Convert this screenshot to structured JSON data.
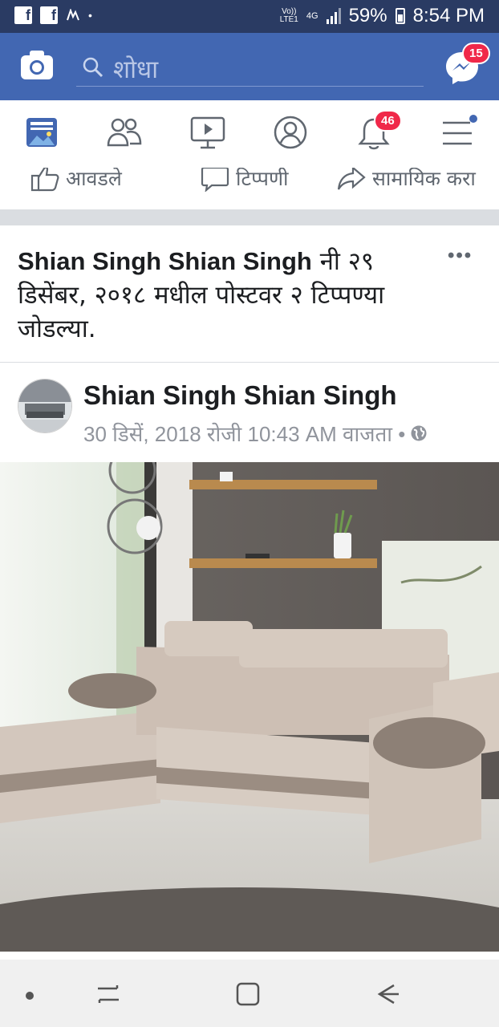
{
  "status_bar": {
    "volte_top": "Vo))",
    "volte_bottom": "LTE1",
    "network": "4G",
    "battery": "59%",
    "time": "8:54 PM"
  },
  "top_bar": {
    "search_placeholder": "शोधा",
    "messenger_badge": "15"
  },
  "nav": {
    "notifications_badge": "46"
  },
  "actions": {
    "like": "आवडले",
    "comment": "टिप्पणी",
    "share": "सामायिक करा"
  },
  "story": {
    "actor": "Shian Singh Shian Singh",
    "text": "नी २९ डिसेंबर, २०१८ मधील पोस्टवर २ टिप्पण्या जोडल्या.",
    "more": "•••"
  },
  "post": {
    "author": "Shian Singh Shian Singh",
    "timestamp": "30 डिसें, 2018 रोजी 10:43 AM वाजता •",
    "privacy_icon": "globe-icon"
  },
  "colors": {
    "status_bar": "#2a3b63",
    "brand": "#4267b2",
    "badge": "#f02849",
    "nav_icon": "#606770"
  }
}
